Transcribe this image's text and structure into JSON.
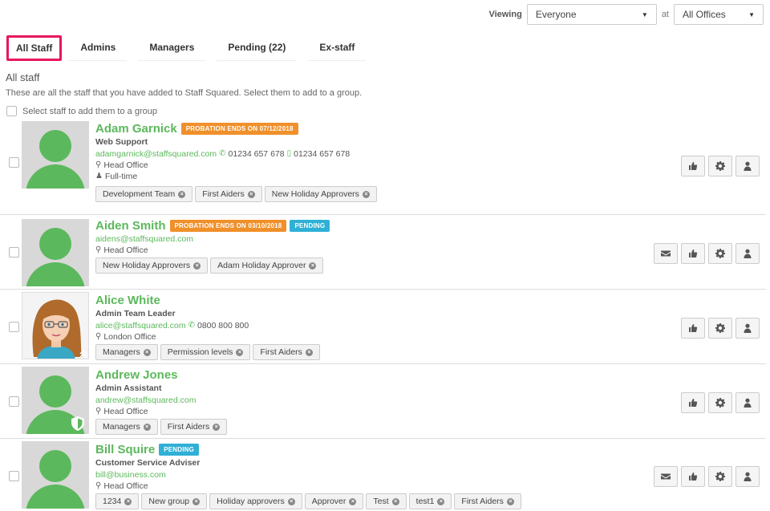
{
  "header": {
    "viewing_label": "Viewing",
    "viewing_value": "Everyone",
    "at_label": "at",
    "office_value": "All Offices"
  },
  "tabs": [
    {
      "label": "All Staff",
      "active": true
    },
    {
      "label": "Admins"
    },
    {
      "label": "Managers"
    },
    {
      "label": "Pending (22)"
    },
    {
      "label": "Ex-staff"
    }
  ],
  "section": {
    "title": "All staff",
    "description": "These are all the staff that you have added to Staff Squared. Select them to add to a group.",
    "select_all_label": "Select staff to add them to a group"
  },
  "staff": [
    {
      "name": "Adam Garnick",
      "badges": [
        {
          "text": "PROBATION ENDS ON 07/12/2018",
          "color": "#f0902a"
        }
      ],
      "job": "Web Support",
      "email": "adamgarnick@staffsquared.com",
      "phone": "01234 657 678",
      "mobile": "01234 657 678",
      "office": "Head Office",
      "employment": "Full-time",
      "tags": [
        "Development Team",
        "First Aiders",
        "New Holiday Approvers"
      ]
    },
    {
      "name": "Aiden Smith",
      "badges": [
        {
          "text": "PROBATION ENDS ON 03/10/2018",
          "color": "#f0902a"
        },
        {
          "text": "PENDING",
          "color": "#2fb0d6"
        }
      ],
      "email": "aidens@staffsquared.com",
      "office": "Head Office",
      "tags": [
        "New Holiday Approvers",
        "Adam Holiday Approver"
      ]
    },
    {
      "name": "Alice White",
      "job": "Admin Team Leader",
      "email": "alice@staffsquared.com",
      "phone": "0800 800 800",
      "office": "London Office",
      "tags": [
        "Managers",
        "Permission levels",
        "First Aiders"
      ]
    },
    {
      "name": "Andrew Jones",
      "job": "Admin Assistant",
      "email": "andrew@staffsquared.com",
      "office": "Head Office",
      "tags": [
        "Managers",
        "First Aiders"
      ]
    },
    {
      "name": "Bill Squire",
      "badges": [
        {
          "text": "PENDING",
          "color": "#2fb0d6"
        }
      ],
      "job": "Customer Service Adviser",
      "email": "bill@business.com",
      "office": "Head Office",
      "tags": [
        "1234",
        "New group",
        "Holiday approvers",
        "Approver",
        "Test",
        "test1",
        "First Aiders"
      ]
    }
  ],
  "icons": {
    "phone": "phone-icon",
    "mobile": "mobile-icon",
    "location": "map-marker-icon",
    "employment": "user-icon",
    "message": "envelope-icon",
    "like": "thumbs-up-icon",
    "settings": "gear-icon",
    "profile": "user-icon"
  }
}
